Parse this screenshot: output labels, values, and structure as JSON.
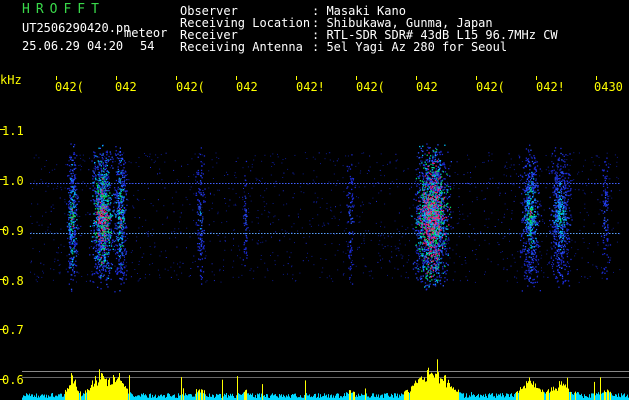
{
  "header": {
    "brand": "HROFFT",
    "filename": "UT2506290420.pn",
    "mode": "meteor",
    "datetime": "25.06.29 04:20",
    "count": "54",
    "labels": {
      "observer": "Observer",
      "location": "Receiving Location",
      "receiver": "Receiver",
      "antenna": "Receiving Antenna"
    },
    "values": {
      "observer": ": Masaki Kano",
      "location": ": Shibukawa, Gunma, Japan",
      "receiver": ": RTL-SDR SDR# 43dB L15 96.7MHz CW",
      "antenna": ": 5el Yagi Az 280 for Seoul"
    }
  },
  "spectrogram": {
    "unit_label": "kHz",
    "y_ticks": [
      "1.1",
      "1.0",
      "0.9",
      "0.8",
      "0.7",
      "0.6"
    ],
    "x_ticks": [
      "042(",
      "042",
      "042(",
      "042",
      "042!",
      "042(",
      "042",
      "042(",
      "042!",
      "0430"
    ],
    "colors": {
      "background": "#000000",
      "axis_labels": "#ffff00",
      "noise": "#1c2bd6",
      "signal_mid": "#00c8ff",
      "signal_hot": "#ff1f7a",
      "histogram": "#ffff00"
    }
  }
}
